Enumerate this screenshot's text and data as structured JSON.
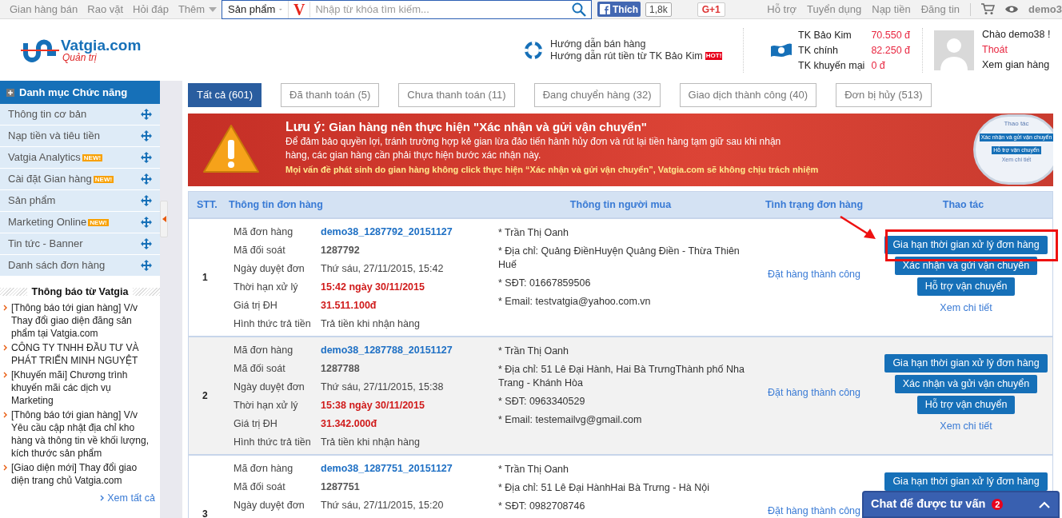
{
  "topbar": {
    "nav_links": [
      "Gian hàng bán",
      "Rao vặt",
      "Hỏi đáp"
    ],
    "more": "Thêm",
    "search": {
      "category": "Sản phẩm",
      "logo": "V",
      "placeholder": "Nhập từ khóa tìm kiếm..."
    },
    "like": {
      "label": "Thích",
      "count": "1,8k"
    },
    "gplus": "G+1",
    "right_links": [
      "Hỗ trợ",
      "Tuyển dụng",
      "Nạp tiền",
      "Đăng tin"
    ],
    "user": "demo3"
  },
  "header": {
    "logo": {
      "name": "Vatgia.com",
      "subtitle": "Quản trị"
    },
    "guides": [
      {
        "label": "Hướng dẫn bán hàng"
      },
      {
        "label": "Hướng dẫn rút tiền từ TK Bảo Kim",
        "badge": "HOT!"
      }
    ],
    "accounts": [
      {
        "label": "TK Bảo Kim",
        "amount": "70.550 đ"
      },
      {
        "label": "TK chính",
        "amount": "82.250 đ"
      },
      {
        "label": "TK khuyến mại",
        "amount": "0 đ"
      }
    ],
    "greeting": "Chào demo38 !",
    "logout": "Thoát",
    "view_shop": "Xem gian hàng"
  },
  "sidebar": {
    "title": "Danh mục Chức năng",
    "items": [
      {
        "label": "Thông tin cơ bản"
      },
      {
        "label": "Nạp tiền và tiêu tiền"
      },
      {
        "label": "Vatgia Analytics",
        "badge": "NEW!"
      },
      {
        "label": "Cài đặt Gian hàng",
        "badge": "NEW!"
      },
      {
        "label": "Sản phẩm"
      },
      {
        "label": "Marketing Online",
        "badge": "NEW!"
      },
      {
        "label": "Tin tức - Banner"
      },
      {
        "label": "Danh sách đơn hàng"
      }
    ],
    "notices_title": "Thông báo từ Vatgia",
    "notices": [
      "[Thông báo tới gian hàng] V/v Thay đổi giao diện đăng sản phẩm tại Vatgia.com",
      "CÔNG TY TNHH ĐẦU TƯ VÀ PHÁT TRIỂN MINH NGUYỆT",
      "[Khuyến mãi] Chương trình khuyến mãi các dịch vụ Marketing",
      "[Thông báo tới gian hàng] V/v Yêu cầu cập nhật địa chỉ kho hàng và thông tin về khối lượng, kích thước sản phẩm",
      "[Giao diện mới] Thay đổi giao diện trang chủ Vatgia.com"
    ],
    "more": "Xem tất cả"
  },
  "tabs": [
    {
      "label": "Tất cả",
      "count": "(601)",
      "selected": true
    },
    {
      "label": "Đã thanh toán",
      "count": "(5)",
      "selected": false
    },
    {
      "label": "Chưa thanh toán",
      "count": "(11)",
      "selected": false
    },
    {
      "label": "Đang chuyển hàng",
      "count": "(32)",
      "selected": false
    },
    {
      "label": "Giao dịch thành công",
      "count": "(40)",
      "selected": false
    },
    {
      "label": "Đơn bị hủy",
      "count": "(513)",
      "selected": false
    }
  ],
  "alert": {
    "title_prefix": "Lưu ý:",
    "title": "Gian hàng nên thực hiện \"Xác nhận và gửi vận chuyển\"",
    "body": "Để đảm bảo quyền lợi, tránh trường hợp kẻ gian lừa đảo tiến hành hủy đơn và rút lại tiền hàng tạm giữ sau khi nhận hàng, các gian hàng cần phải thực hiện bước xác nhận này.",
    "note": "Mọi vấn đề phát sinh do gian hàng không click thực hiện “Xác nhận và gửi vận chuyển”, Vatgia.com sẽ không chịu trách nhiệm",
    "preview": {
      "header": "Thao tác",
      "buttons": [
        "Xác nhận và gửi vận chuyển",
        "Hỗ trợ vận chuyển"
      ],
      "link": "Xem chi tiết"
    }
  },
  "table": {
    "columns": [
      "STT.",
      "Thông tin đơn hàng",
      "Thông tin người mua",
      "Tình trạng đơn hàng",
      "Thao tác"
    ],
    "rows": [
      {
        "stt": "1",
        "selected": false,
        "fields": [
          {
            "label": "Mã đơn hàng",
            "value": "demo38_1287792_20151127",
            "kind": "link"
          },
          {
            "label": "Mã đối soát",
            "value": "1287792",
            "kind": "bold"
          },
          {
            "label": "Ngày duyệt đơn",
            "value": "Thứ sáu, 27/11/2015, 15:42",
            "kind": "plain"
          },
          {
            "label": "Thời hạn xử lý",
            "value": "15:42 ngày 30/11/2015",
            "kind": "red"
          },
          {
            "label": "Giá trị ĐH",
            "value": "31.511.100đ",
            "kind": "red"
          },
          {
            "label": "Hình thức trả tiền",
            "value": "Trả tiền khi nhận hàng",
            "kind": "plain"
          }
        ],
        "buyer": [
          "* Trần Thị Oanh",
          "* Địa chỉ: Quảng ĐiềnHuyện Quảng Điền - Thừa Thiên Huế",
          "* SĐT: 01667859506",
          "* Email: testvatgia@yahoo.com.vn"
        ],
        "status": "Đặt hàng thành công",
        "actions": [
          "Gia hạn thời gian xử lý đơn hàng",
          "Xác nhận và gửi vận chuyển",
          "Hỗ trợ vận chuyển"
        ],
        "detail": "Xem chi tiết",
        "highlighted": true
      },
      {
        "stt": "2",
        "selected": true,
        "fields": [
          {
            "label": "Mã đơn hàng",
            "value": "demo38_1287788_20151127",
            "kind": "link"
          },
          {
            "label": "Mã đối soát",
            "value": "1287788",
            "kind": "bold"
          },
          {
            "label": "Ngày duyệt đơn",
            "value": "Thứ sáu, 27/11/2015, 15:38",
            "kind": "plain"
          },
          {
            "label": "Thời hạn xử lý",
            "value": "15:38 ngày 30/11/2015",
            "kind": "red"
          },
          {
            "label": "Giá trị ĐH",
            "value": "31.342.000đ",
            "kind": "red"
          },
          {
            "label": "Hình thức trả tiền",
            "value": "Trả tiền khi nhận hàng",
            "kind": "plain"
          }
        ],
        "buyer": [
          "* Trần Thị Oanh",
          "* Địa chỉ: 51 Lê Đại Hành, Hai Bà TrưngThành phố Nha Trang - Khánh Hòa",
          "* SĐT: 0963340529",
          "* Email: testemailvg@gmail.com"
        ],
        "status": "Đặt hàng thành công",
        "actions": [
          "Gia hạn thời gian xử lý đơn hàng",
          "Xác nhận và gửi vận chuyển",
          "Hỗ trợ vận chuyển"
        ],
        "detail": "Xem chi tiết",
        "highlighted": false
      },
      {
        "stt": "3",
        "selected": false,
        "fields": [
          {
            "label": "Mã đơn hàng",
            "value": "demo38_1287751_20151127",
            "kind": "link"
          },
          {
            "label": "Mã đối soát",
            "value": "1287751",
            "kind": "bold"
          },
          {
            "label": "Ngày duyệt đơn",
            "value": "Thứ sáu, 27/11/2015, 15:20",
            "kind": "plain"
          }
        ],
        "buyer": [
          "* Trần Thị Oanh",
          "* Địa chỉ: 51 Lê Đại HànhHai Bà Trưng - Hà Nội",
          "* SĐT: 0982708746"
        ],
        "status": "Đặt hàng thành công",
        "actions": [
          "Gia hạn thời gian xử lý đơn hàng"
        ],
        "highlighted": false
      }
    ]
  },
  "chat": {
    "label": "Chat để được tư vấn",
    "count": "2"
  }
}
